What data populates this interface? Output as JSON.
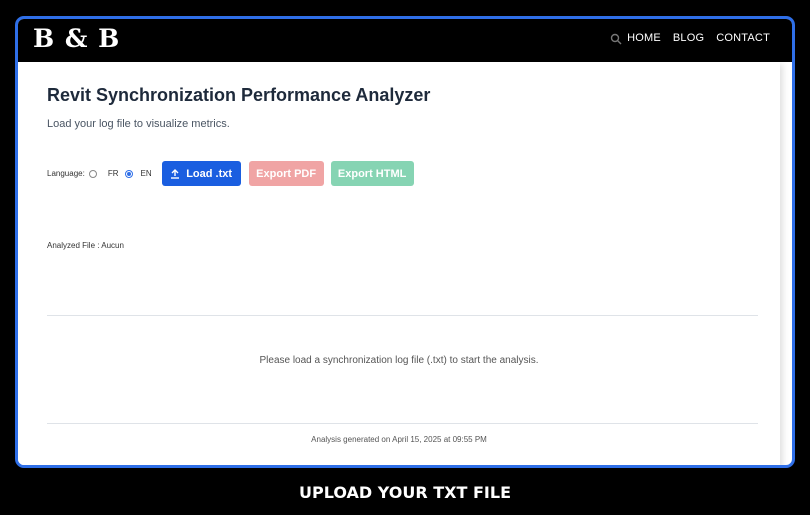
{
  "header": {
    "logo": "B & B",
    "nav": [
      "HOME",
      "BLOG",
      "CONTACT"
    ]
  },
  "main": {
    "title": "Revit Synchronization Performance Analyzer",
    "subtitle": "Load your log file to visualize metrics.",
    "language_label": "Language:",
    "languages": [
      "FR",
      "EN"
    ],
    "selected_language": "EN",
    "load_button": "Load .txt",
    "export_pdf": "Export PDF",
    "export_html": "Export HTML",
    "analyzed_file": "Analyzed File : Aucun",
    "placeholder_message": "Please load a synchronization log file (.txt) to start the analysis.",
    "footer": "Analysis generated on April 15, 2025 at 09:55 PM"
  },
  "caption": "UPLOAD YOUR TXT FILE",
  "colors": {
    "frame_border": "#2f6fe8",
    "load_button": "#1a5ee0",
    "export_pdf": "#f0a4a4",
    "export_html": "#86d4b3"
  },
  "icons": [
    "search-icon",
    "upload-icon"
  ]
}
